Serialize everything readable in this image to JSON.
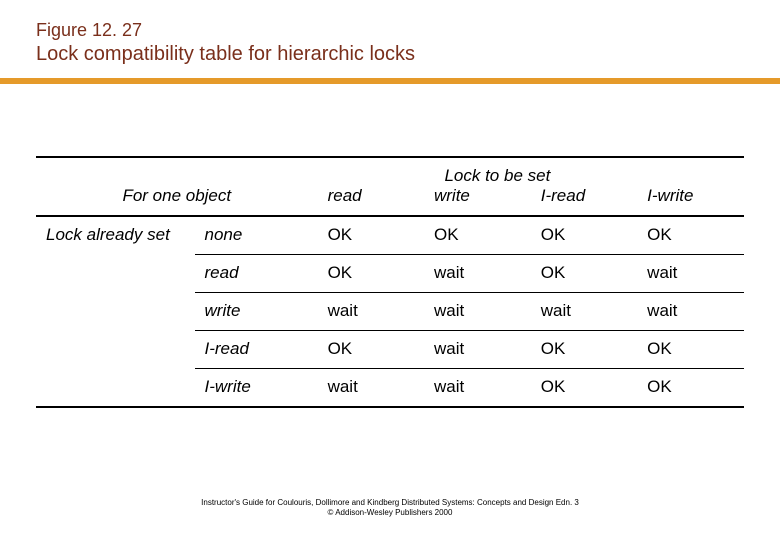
{
  "figure_number": "Figure 12. 27",
  "figure_title": "Lock compatibility table for hierarchic locks",
  "headers": {
    "for_one_object": "For one object",
    "lock_to_be_set": "Lock to be set",
    "lock_already_set": "Lock already set",
    "req": {
      "read": "read",
      "write": "write",
      "iread": "I-read",
      "iwrite": "I-write"
    }
  },
  "rows": [
    {
      "state": "none",
      "read": "OK",
      "write": "OK",
      "iread": "OK",
      "iwrite": "OK"
    },
    {
      "state": "read",
      "read": "OK",
      "write": "wait",
      "iread": "OK",
      "iwrite": "wait"
    },
    {
      "state": "write",
      "read": "wait",
      "write": "wait",
      "iread": "wait",
      "iwrite": "wait"
    },
    {
      "state": "I-read",
      "read": "OK",
      "write": "wait",
      "iread": "OK",
      "iwrite": "OK"
    },
    {
      "state": "I-write",
      "read": "wait",
      "write": "wait",
      "iread": "OK",
      "iwrite": "OK"
    }
  ],
  "footer": {
    "line1": "Instructor's Guide for  Coulouris, Dollimore and Kindberg   Distributed Systems: Concepts and Design   Edn. 3",
    "line2": "©  Addison-Wesley Publishers 2000"
  },
  "chart_data": {
    "type": "table",
    "title": "Lock compatibility table for hierarchic locks",
    "row_dimension": "Lock already set",
    "col_dimension": "Lock to be set",
    "columns": [
      "read",
      "write",
      "I-read",
      "I-write"
    ],
    "rows": [
      "none",
      "read",
      "write",
      "I-read",
      "I-write"
    ],
    "cells": [
      [
        "OK",
        "OK",
        "OK",
        "OK"
      ],
      [
        "OK",
        "wait",
        "OK",
        "wait"
      ],
      [
        "wait",
        "wait",
        "wait",
        "wait"
      ],
      [
        "OK",
        "wait",
        "OK",
        "OK"
      ],
      [
        "wait",
        "wait",
        "OK",
        "OK"
      ]
    ]
  }
}
